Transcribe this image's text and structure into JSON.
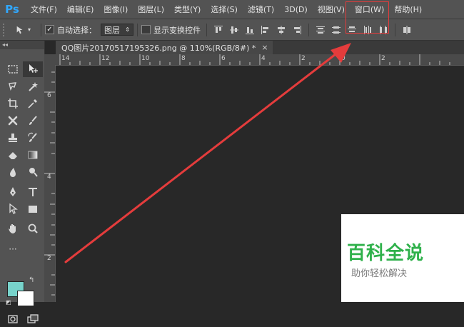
{
  "app": {
    "logo": "Ps"
  },
  "menu": {
    "items": [
      {
        "label": "文件(F)"
      },
      {
        "label": "编辑(E)"
      },
      {
        "label": "图像(I)"
      },
      {
        "label": "图层(L)"
      },
      {
        "label": "类型(Y)"
      },
      {
        "label": "选择(S)"
      },
      {
        "label": "滤镜(T)"
      },
      {
        "label": "3D(D)"
      },
      {
        "label": "视图(V)"
      },
      {
        "label": "窗口(W)"
      },
      {
        "label": "帮助(H)"
      }
    ],
    "highlighted": "窗口(W)"
  },
  "options": {
    "auto_select_label": "自动选择：",
    "auto_select_checked": true,
    "auto_select_value": "图层",
    "show_transform_label": "显示变换控件",
    "show_transform_checked": false
  },
  "document": {
    "tab_title": "QQ图片20170517195326.png @ 110%(RGB/8#) *",
    "close_glyph": "×"
  },
  "rulers": {
    "top": [
      "14",
      "12",
      "10",
      "8",
      "6",
      "4",
      "2",
      "0",
      "2"
    ],
    "left": [
      "6",
      "4",
      "2"
    ]
  },
  "colors": {
    "foreground": "#78d3cb",
    "background": "#ffffff",
    "annotation": "#e43c3c"
  },
  "watermark": {
    "title": "百科全说",
    "subtitle": "助你轻松解决"
  }
}
